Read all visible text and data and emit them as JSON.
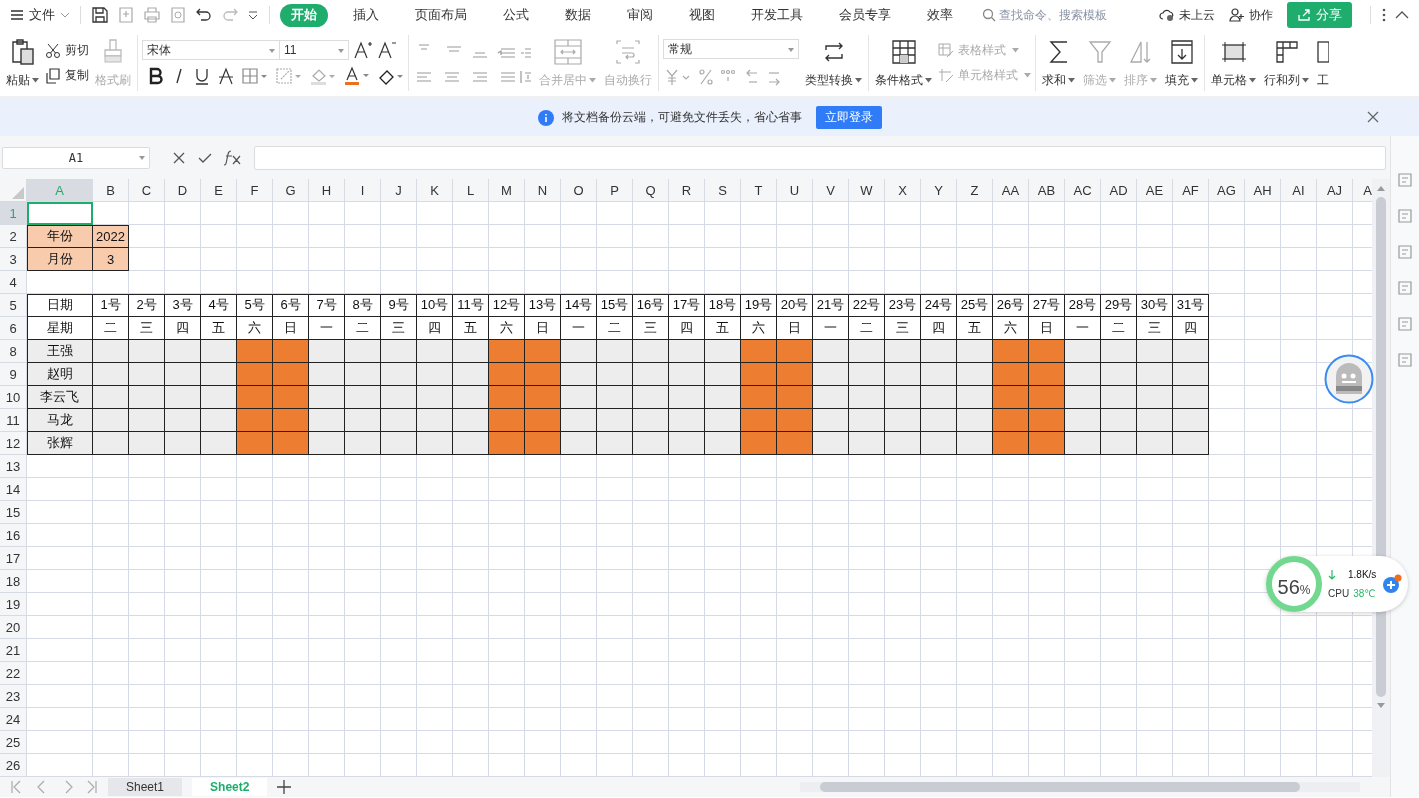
{
  "menu": {
    "file": "文件",
    "tabs": [
      {
        "label": "开始",
        "selected": true
      },
      {
        "label": "插入",
        "selected": false
      },
      {
        "label": "页面布局",
        "selected": false
      },
      {
        "label": "公式",
        "selected": false
      },
      {
        "label": "数据",
        "selected": false
      },
      {
        "label": "审阅",
        "selected": false
      },
      {
        "label": "视图",
        "selected": false
      },
      {
        "label": "开发工具",
        "selected": false
      },
      {
        "label": "会员专享",
        "selected": false
      },
      {
        "label": "效率",
        "selected": false
      }
    ],
    "search_placeholder": "查找命令、搜索模板",
    "cloud": "未上云",
    "collab": "协作",
    "share": "分享"
  },
  "ribbon": {
    "paste": "粘贴",
    "cut": "剪切",
    "copy": "复制",
    "format_painter": {
      "label": "格式刷",
      "disabled": true
    },
    "font": "宋体",
    "font_size": "11",
    "merge": {
      "label": "合并居中",
      "disabled": true
    },
    "wrap": {
      "label": "自动换行",
      "disabled": true
    },
    "number_format": "常规",
    "type_convert": "类型转换",
    "conditional": "条件格式",
    "table_style": {
      "label": "表格样式",
      "disabled": true
    },
    "cell_style": {
      "label": "单元格样式",
      "disabled": true
    },
    "tools": [
      {
        "kind": "sum",
        "label": "求和",
        "disabled": false
      },
      {
        "kind": "filter",
        "label": "筛选",
        "disabled": true
      },
      {
        "kind": "sort",
        "label": "排序",
        "disabled": true
      },
      {
        "kind": "fill",
        "label": "填充",
        "disabled": false
      },
      {
        "kind": "cell",
        "label": "单元格",
        "disabled": false
      },
      {
        "kind": "rowcol",
        "label": "行和列",
        "disabled": false
      },
      {
        "kind": "sheet",
        "label": "工",
        "disabled": false
      }
    ]
  },
  "notice": {
    "text": "将文档备份云端，可避免文件丢失，省心省事",
    "button": "立即登录"
  },
  "formula_bar": {
    "name_box": "A1"
  },
  "sheet": {
    "columns": [
      {
        "label": "A",
        "selected": true
      },
      {
        "label": "B",
        "selected": false
      },
      {
        "label": "C",
        "selected": false
      },
      {
        "label": "D",
        "selected": false
      },
      {
        "label": "E",
        "selected": false
      },
      {
        "label": "F",
        "selected": false
      },
      {
        "label": "G",
        "selected": false
      },
      {
        "label": "H",
        "selected": false
      },
      {
        "label": "I",
        "selected": false
      },
      {
        "label": "J",
        "selected": false
      },
      {
        "label": "K",
        "selected": false
      },
      {
        "label": "L",
        "selected": false
      },
      {
        "label": "M",
        "selected": false
      },
      {
        "label": "N",
        "selected": false
      },
      {
        "label": "O",
        "selected": false
      },
      {
        "label": "P",
        "selected": false
      },
      {
        "label": "Q",
        "selected": false
      },
      {
        "label": "R",
        "selected": false
      },
      {
        "label": "S",
        "selected": false
      },
      {
        "label": "T",
        "selected": false
      },
      {
        "label": "U",
        "selected": false
      },
      {
        "label": "V",
        "selected": false
      },
      {
        "label": "W",
        "selected": false
      },
      {
        "label": "X",
        "selected": false
      },
      {
        "label": "Y",
        "selected": false
      },
      {
        "label": "Z",
        "selected": false
      },
      {
        "label": "AA",
        "selected": false
      },
      {
        "label": "AB",
        "selected": false
      },
      {
        "label": "AC",
        "selected": false
      },
      {
        "label": "AD",
        "selected": false
      },
      {
        "label": "AE",
        "selected": false
      },
      {
        "label": "AF",
        "selected": false
      },
      {
        "label": "AG",
        "selected": false
      },
      {
        "label": "AH",
        "selected": false
      },
      {
        "label": "AI",
        "selected": false
      },
      {
        "label": "AJ",
        "selected": false
      },
      {
        "label": "A",
        "selected": false
      }
    ],
    "rows": [
      {
        "label": "1",
        "selected": true
      },
      {
        "label": "2",
        "selected": false
      },
      {
        "label": "3",
        "selected": false
      },
      {
        "label": "4",
        "selected": false
      },
      {
        "label": "5",
        "selected": false
      },
      {
        "label": "6",
        "selected": false
      },
      {
        "label": "8",
        "selected": false
      },
      {
        "label": "9",
        "selected": false
      },
      {
        "label": "10",
        "selected": false
      },
      {
        "label": "11",
        "selected": false
      },
      {
        "label": "12",
        "selected": false
      },
      {
        "label": "13",
        "selected": false
      },
      {
        "label": "14",
        "selected": false
      },
      {
        "label": "15",
        "selected": false
      },
      {
        "label": "16",
        "selected": false
      },
      {
        "label": "17",
        "selected": false
      },
      {
        "label": "18",
        "selected": false
      },
      {
        "label": "19",
        "selected": false
      },
      {
        "label": "20",
        "selected": false
      },
      {
        "label": "21",
        "selected": false
      },
      {
        "label": "22",
        "selected": false
      },
      {
        "label": "23",
        "selected": false
      },
      {
        "label": "24",
        "selected": false
      },
      {
        "label": "25",
        "selected": false
      },
      {
        "label": "26",
        "selected": false
      }
    ],
    "year_label": "年份",
    "year": "2022",
    "month_label": "月份",
    "month": "3",
    "date_label": "日期",
    "weekday_label": "星期",
    "days": [
      {
        "date": "1号",
        "weekday": "二",
        "weekend": false
      },
      {
        "date": "2号",
        "weekday": "三",
        "weekend": false
      },
      {
        "date": "3号",
        "weekday": "四",
        "weekend": false
      },
      {
        "date": "4号",
        "weekday": "五",
        "weekend": false
      },
      {
        "date": "5号",
        "weekday": "六",
        "weekend": true
      },
      {
        "date": "6号",
        "weekday": "日",
        "weekend": true
      },
      {
        "date": "7号",
        "weekday": "一",
        "weekend": false
      },
      {
        "date": "8号",
        "weekday": "二",
        "weekend": false
      },
      {
        "date": "9号",
        "weekday": "三",
        "weekend": false
      },
      {
        "date": "10号",
        "weekday": "四",
        "weekend": false
      },
      {
        "date": "11号",
        "weekday": "五",
        "weekend": false
      },
      {
        "date": "12号",
        "weekday": "六",
        "weekend": true
      },
      {
        "date": "13号",
        "weekday": "日",
        "weekend": true
      },
      {
        "date": "14号",
        "weekday": "一",
        "weekend": false
      },
      {
        "date": "15号",
        "weekday": "二",
        "weekend": false
      },
      {
        "date": "16号",
        "weekday": "三",
        "weekend": false
      },
      {
        "date": "17号",
        "weekday": "四",
        "weekend": false
      },
      {
        "date": "18号",
        "weekday": "五",
        "weekend": false
      },
      {
        "date": "19号",
        "weekday": "六",
        "weekend": true
      },
      {
        "date": "20号",
        "weekday": "日",
        "weekend": true
      },
      {
        "date": "21号",
        "weekday": "一",
        "weekend": false
      },
      {
        "date": "22号",
        "weekday": "二",
        "weekend": false
      },
      {
        "date": "23号",
        "weekday": "三",
        "weekend": false
      },
      {
        "date": "24号",
        "weekday": "四",
        "weekend": false
      },
      {
        "date": "25号",
        "weekday": "五",
        "weekend": false
      },
      {
        "date": "26号",
        "weekday": "六",
        "weekend": true
      },
      {
        "date": "27号",
        "weekday": "日",
        "weekend": true
      },
      {
        "date": "28号",
        "weekday": "一",
        "weekend": false
      },
      {
        "date": "29号",
        "weekday": "二",
        "weekend": false
      },
      {
        "date": "30号",
        "weekday": "三",
        "weekend": false
      },
      {
        "date": "31号",
        "weekday": "四",
        "weekend": false
      }
    ],
    "employees": [
      "王强",
      "赵明",
      "李云飞",
      "马龙",
      "张辉"
    ]
  },
  "sheet_tabs": [
    {
      "label": "Sheet1",
      "selected": false
    },
    {
      "label": "Sheet2",
      "selected": true
    }
  ],
  "monitor": {
    "memory": "56",
    "memory_unit": "%",
    "net_speed": "1.8K/s",
    "cpu_label": "CPU",
    "cpu_temp": "38℃"
  }
}
